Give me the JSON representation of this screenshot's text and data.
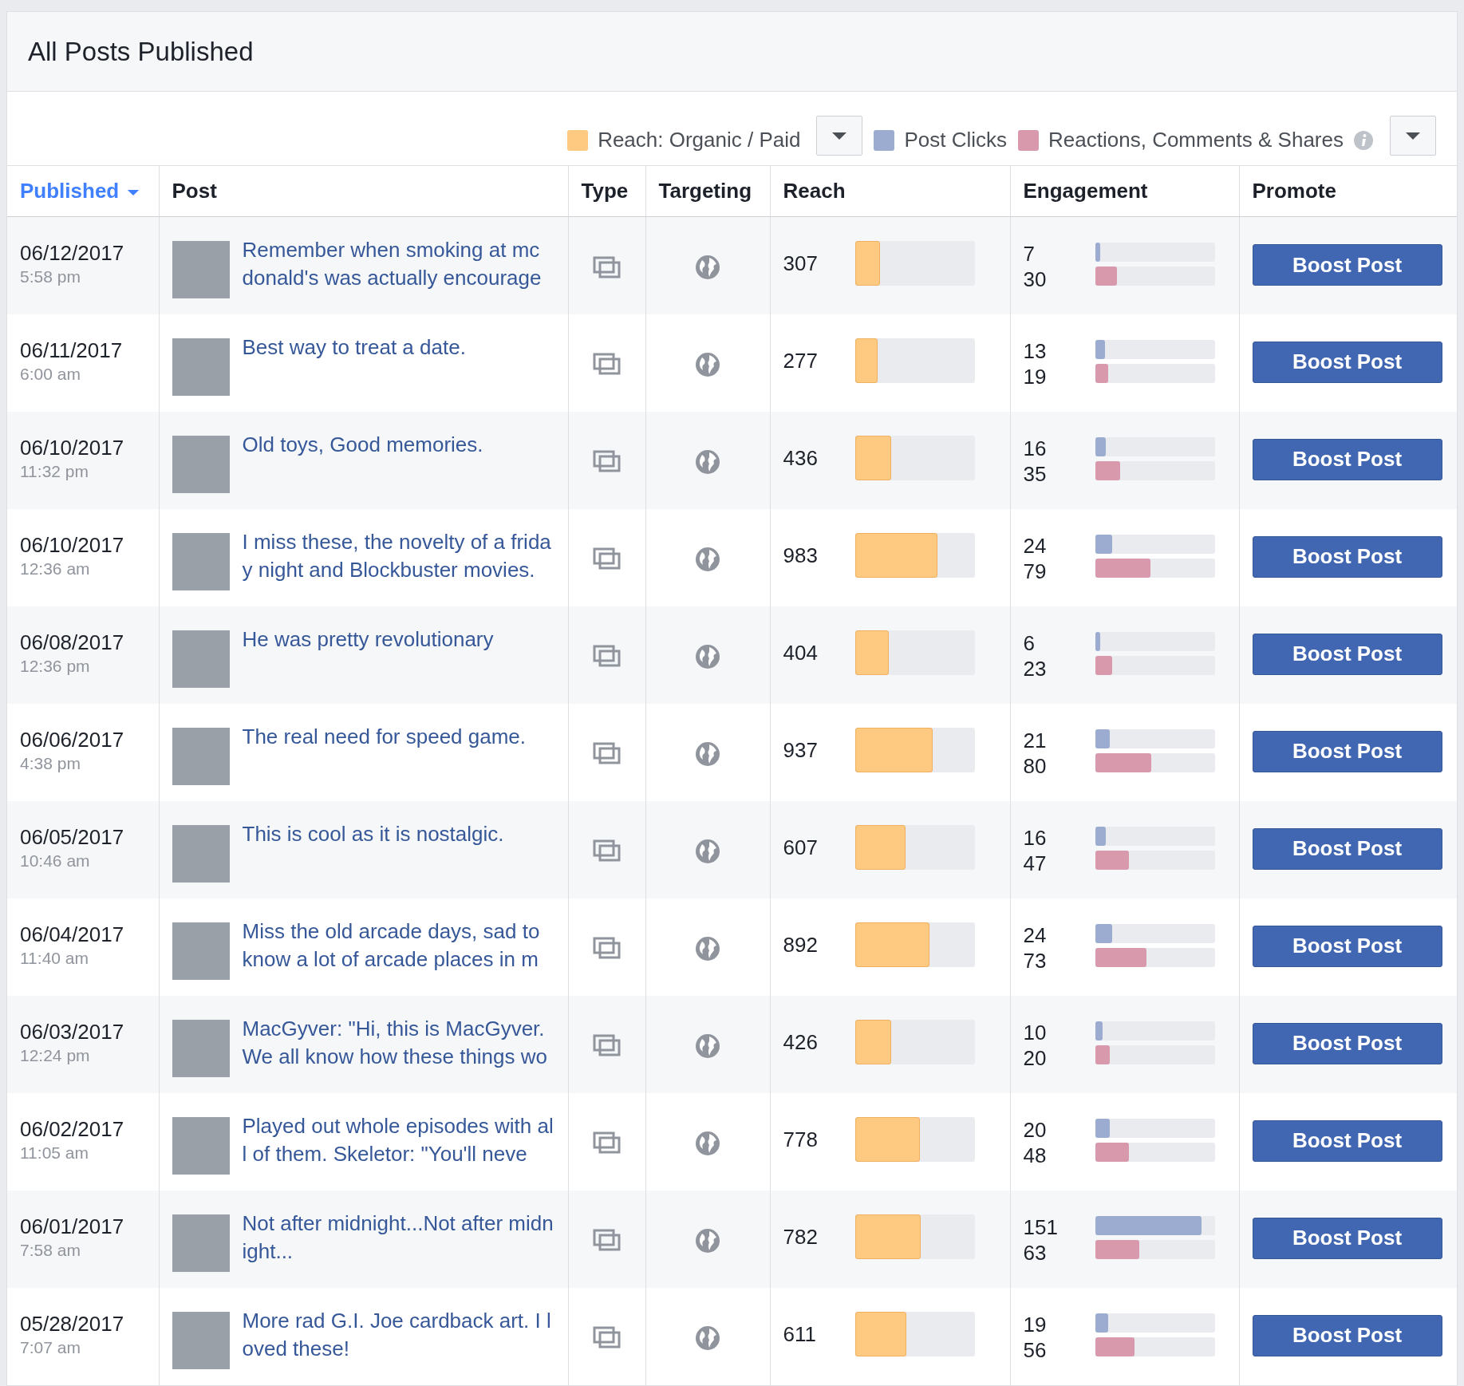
{
  "title": "All Posts Published",
  "legend": [
    {
      "label": "Reach: Organic / Paid",
      "color": "#fec981",
      "dropdown": true
    },
    {
      "label": "Post Clicks",
      "color": "#9cacd1",
      "dropdown": false
    },
    {
      "label": "Reactions, Comments & Shares",
      "color": "#d899ad",
      "dropdown": true,
      "info": true
    }
  ],
  "columns": [
    {
      "label": "Published",
      "sorted": true
    },
    {
      "label": "Post",
      "sorted": false
    },
    {
      "label": "Type",
      "sorted": false
    },
    {
      "label": "Targeting",
      "sorted": false
    },
    {
      "label": "Reach",
      "sorted": false
    },
    {
      "label": "Engagement",
      "sorted": false
    },
    {
      "label": "Promote",
      "sorted": false
    }
  ],
  "rows": [
    {
      "date": "06/12/2017",
      "time": "5:58 pm",
      "text": "Remember when smoking at mc donald's was actually encourage",
      "reach": "307",
      "reach_bar": {
        "level": 0.21
      },
      "clicks": "7",
      "clicks_bar": {
        "level": 0.04
      },
      "reactions": "30",
      "reactions_bar": {
        "level": 0.18
      },
      "button": "Boost Post"
    },
    {
      "date": "06/11/2017",
      "time": "6:00 am",
      "text": "Best way to treat a date.",
      "reach": "277",
      "reach_bar": {
        "level": 0.19
      },
      "clicks": "13",
      "clicks_bar": {
        "level": 0.08
      },
      "reactions": "19",
      "reactions_bar": {
        "level": 0.11
      },
      "button": "Boost Post"
    },
    {
      "date": "06/10/2017",
      "time": "11:32 pm",
      "text": "Old toys, Good memories.",
      "reach": "436",
      "reach_bar": {
        "level": 0.3
      },
      "clicks": "16",
      "clicks_bar": {
        "level": 0.09
      },
      "reactions": "35",
      "reactions_bar": {
        "level": 0.21
      },
      "button": "Boost Post"
    },
    {
      "date": "06/10/2017",
      "time": "12:36 am",
      "text": "I miss these, the novelty of a friday night and Blockbuster movies.",
      "reach": "983",
      "reach_bar": {
        "level": 0.69
      },
      "clicks": "24",
      "clicks_bar": {
        "level": 0.14
      },
      "reactions": "79",
      "reactions_bar": {
        "level": 0.46
      },
      "button": "Boost Post"
    },
    {
      "date": "06/08/2017",
      "time": "12:36 pm",
      "text": "He was pretty revolutionary",
      "reach": "404",
      "reach_bar": {
        "level": 0.28
      },
      "clicks": "6",
      "clicks_bar": {
        "level": 0.04
      },
      "reactions": "23",
      "reactions_bar": {
        "level": 0.14
      },
      "button": "Boost Post"
    },
    {
      "date": "06/06/2017",
      "time": "4:38 pm",
      "text": "The real need for speed game.",
      "reach": "937",
      "reach_bar": {
        "level": 0.65
      },
      "clicks": "21",
      "clicks_bar": {
        "level": 0.12
      },
      "reactions": "80",
      "reactions_bar": {
        "level": 0.47
      },
      "button": "Boost Post"
    },
    {
      "date": "06/05/2017",
      "time": "10:46 am",
      "text": "This is cool as it is nostalgic.",
      "reach": "607",
      "reach_bar": {
        "level": 0.42
      },
      "clicks": "16",
      "clicks_bar": {
        "level": 0.09
      },
      "reactions": "47",
      "reactions_bar": {
        "level": 0.28
      },
      "button": "Boost Post"
    },
    {
      "date": "06/04/2017",
      "time": "11:40 am",
      "text": "Miss the old arcade days, sad to know a lot of arcade places in m",
      "reach": "892",
      "reach_bar": {
        "level": 0.62
      },
      "clicks": "24",
      "clicks_bar": {
        "level": 0.14
      },
      "reactions": "73",
      "reactions_bar": {
        "level": 0.43
      },
      "button": "Boost Post"
    },
    {
      "date": "06/03/2017",
      "time": "12:24 pm",
      "text": "MacGyver: \"Hi, this is MacGyver. We all know how these things wo",
      "reach": "426",
      "reach_bar": {
        "level": 0.3
      },
      "clicks": "10",
      "clicks_bar": {
        "level": 0.06
      },
      "reactions": "20",
      "reactions_bar": {
        "level": 0.12
      },
      "button": "Boost Post"
    },
    {
      "date": "06/02/2017",
      "time": "11:05 am",
      "text": "Played out whole episodes with all of them. Skeletor: \"You'll neve",
      "reach": "778",
      "reach_bar": {
        "level": 0.54
      },
      "clicks": "20",
      "clicks_bar": {
        "level": 0.12
      },
      "reactions": "48",
      "reactions_bar": {
        "level": 0.28
      },
      "button": "Boost Post"
    },
    {
      "date": "06/01/2017",
      "time": "7:58 am",
      "text": "Not after midnight...Not after midnight...",
      "reach": "782",
      "reach_bar": {
        "level": 0.55
      },
      "clicks": "151",
      "clicks_bar": {
        "level": 0.89
      },
      "reactions": "63",
      "reactions_bar": {
        "level": 0.37
      },
      "button": "Boost Post"
    },
    {
      "date": "05/28/2017",
      "time": "7:07 am",
      "text": "More rad G.I. Joe cardback art. I loved these!",
      "reach": "611",
      "reach_bar": {
        "level": 0.43
      },
      "clicks": "19",
      "clicks_bar": {
        "level": 0.11
      },
      "reactions": "56",
      "reactions_bar": {
        "level": 0.33
      },
      "button": "Boost Post"
    }
  ]
}
